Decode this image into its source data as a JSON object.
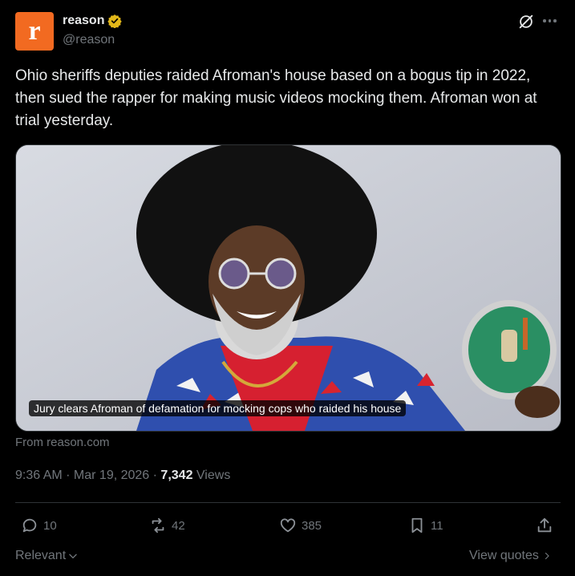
{
  "tweet": {
    "author": {
      "avatar_letter": "r",
      "display_name": "reason",
      "handle": "@reason",
      "verified_icon": "verified-badge-gold",
      "avatar_color": "#f26a21"
    },
    "text": "Ohio sheriffs deputies raided Afroman's house based on a bogus tip in 2022, then sued the rapper for making music videos mocking them. Afroman won at trial yesterday.",
    "card": {
      "caption": "Jury clears Afroman of defamation for mocking cops who raided his house",
      "source": "From reason.com"
    },
    "meta": {
      "time": "9:36 AM",
      "separator": " · ",
      "date": "Mar 19, 2026",
      "views_count": "7,342",
      "views_label": "Views"
    },
    "actions": {
      "replies": "10",
      "reposts": "42",
      "likes": "385",
      "bookmarks": "11"
    },
    "footer": {
      "sort_label": "Relevant",
      "view_quotes": "View quotes"
    }
  },
  "colors": {
    "background": "#000000",
    "text_primary": "#e7e9ea",
    "text_secondary": "#71767b",
    "border": "#2f3336"
  }
}
